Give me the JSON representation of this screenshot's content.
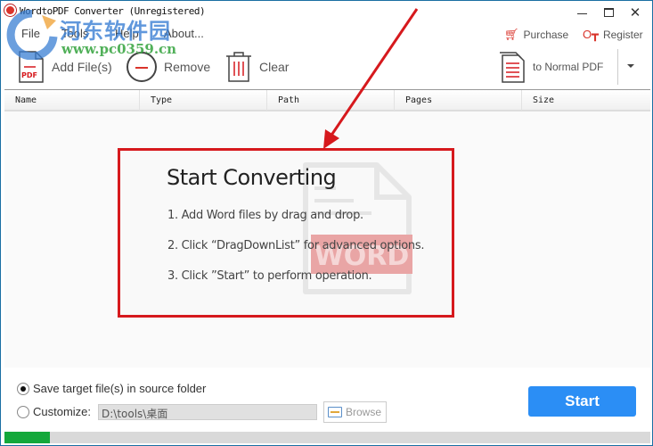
{
  "window": {
    "title": "WordtoPDF Converter (Unregistered)",
    "controls": {
      "minimize": "minimize",
      "maximize": "maximize",
      "close": "close"
    }
  },
  "menu": {
    "items": [
      {
        "label": "File"
      },
      {
        "label": "Tools"
      },
      {
        "label": "Help"
      },
      {
        "label": "About..."
      }
    ]
  },
  "top_links": {
    "purchase": "Purchase",
    "register": "Register"
  },
  "toolbar": {
    "add_files": "Add File(s)",
    "remove": "Remove",
    "clear": "Clear",
    "convert_mode": "to Normal PDF",
    "pdf_icon_text": "PDF"
  },
  "file_list": {
    "columns": [
      "Name",
      "Type",
      "Path",
      "Pages",
      "Size"
    ],
    "rows": []
  },
  "guide": {
    "title": "Start Converting",
    "steps": [
      "1. Add Word files by drag and drop.",
      "2. Click “DragDownList” for advanced options.",
      "3. Click ”Start” to perform operation."
    ],
    "watermark_text": "WORD"
  },
  "output": {
    "save_in_source_label": "Save target file(s) in source folder",
    "save_in_source_selected": true,
    "customize_label": "Customize:",
    "customize_selected": false,
    "path_value": "D:\\tools\\桌面",
    "browse_label": "Browse"
  },
  "actions": {
    "start_label": "Start"
  },
  "progress": {
    "percent": 7
  },
  "site_watermark": {
    "name": "河东软件园",
    "url": "www.pc0359.cn"
  },
  "colors": {
    "accent_red": "#d6191d",
    "start_blue": "#2b8ef5",
    "progress_green": "#14a83b",
    "window_border": "#1a6fa3"
  }
}
